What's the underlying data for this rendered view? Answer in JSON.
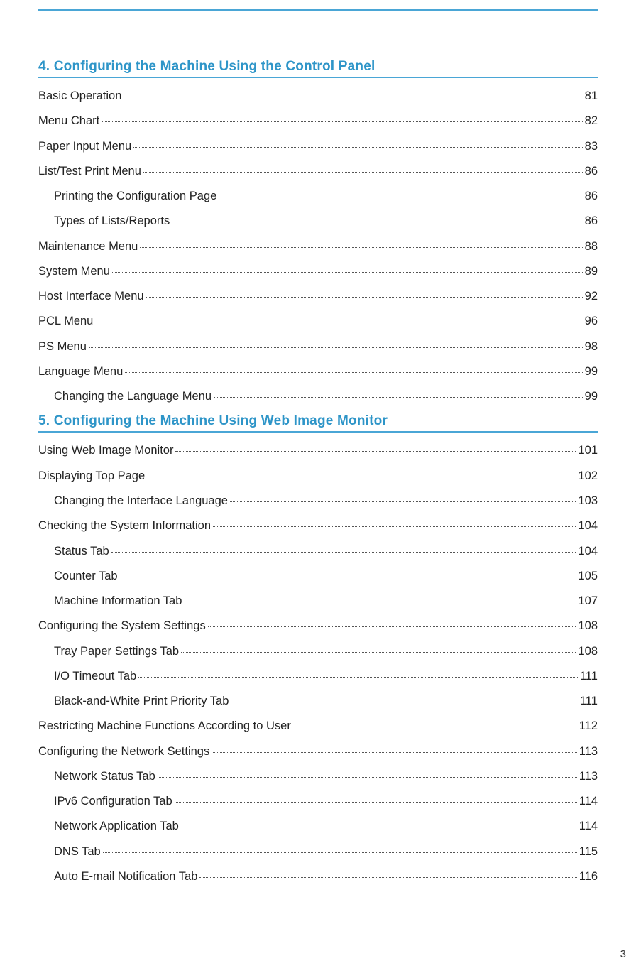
{
  "pageNumber": "3",
  "sections": [
    {
      "title": "4. Configuring the Machine Using the Control Panel",
      "entries": [
        {
          "label": "Basic Operation",
          "page": "81",
          "sub": false
        },
        {
          "label": "Menu Chart",
          "page": "82",
          "sub": false
        },
        {
          "label": "Paper Input Menu",
          "page": "83",
          "sub": false
        },
        {
          "label": "List/Test Print Menu",
          "page": "86",
          "sub": false
        },
        {
          "label": "Printing the Configuration Page",
          "page": "86",
          "sub": true
        },
        {
          "label": "Types of Lists/Reports",
          "page": "86",
          "sub": true
        },
        {
          "label": "Maintenance Menu",
          "page": "88",
          "sub": false
        },
        {
          "label": "System Menu",
          "page": "89",
          "sub": false
        },
        {
          "label": "Host Interface Menu",
          "page": "92",
          "sub": false
        },
        {
          "label": "PCL Menu",
          "page": "96",
          "sub": false
        },
        {
          "label": "PS Menu",
          "page": "98",
          "sub": false
        },
        {
          "label": "Language Menu",
          "page": "99",
          "sub": false
        },
        {
          "label": "Changing the Language Menu",
          "page": "99",
          "sub": true
        }
      ]
    },
    {
      "title": "5. Configuring the Machine Using Web Image Monitor",
      "entries": [
        {
          "label": "Using Web Image Monitor",
          "page": "101",
          "sub": false
        },
        {
          "label": "Displaying Top Page",
          "page": "102",
          "sub": false
        },
        {
          "label": "Changing the Interface Language",
          "page": "103",
          "sub": true
        },
        {
          "label": "Checking the System Information",
          "page": "104",
          "sub": false
        },
        {
          "label": "Status Tab",
          "page": "104",
          "sub": true
        },
        {
          "label": "Counter Tab",
          "page": "105",
          "sub": true
        },
        {
          "label": "Machine Information Tab",
          "page": "107",
          "sub": true
        },
        {
          "label": "Configuring the System Settings",
          "page": "108",
          "sub": false
        },
        {
          "label": "Tray Paper Settings Tab",
          "page": "108",
          "sub": true
        },
        {
          "label": "I/O Timeout Tab",
          "page": "111",
          "sub": true
        },
        {
          "label": "Black-and-White Print Priority Tab",
          "page": "111",
          "sub": true
        },
        {
          "label": "Restricting Machine Functions According to User",
          "page": "112",
          "sub": false
        },
        {
          "label": "Configuring the Network Settings",
          "page": "113",
          "sub": false
        },
        {
          "label": "Network Status Tab",
          "page": "113",
          "sub": true
        },
        {
          "label": "IPv6 Configuration Tab",
          "page": "114",
          "sub": true
        },
        {
          "label": "Network Application Tab",
          "page": "114",
          "sub": true
        },
        {
          "label": "DNS Tab",
          "page": "115",
          "sub": true
        },
        {
          "label": "Auto E-mail Notification Tab",
          "page": "116",
          "sub": true
        }
      ]
    }
  ]
}
